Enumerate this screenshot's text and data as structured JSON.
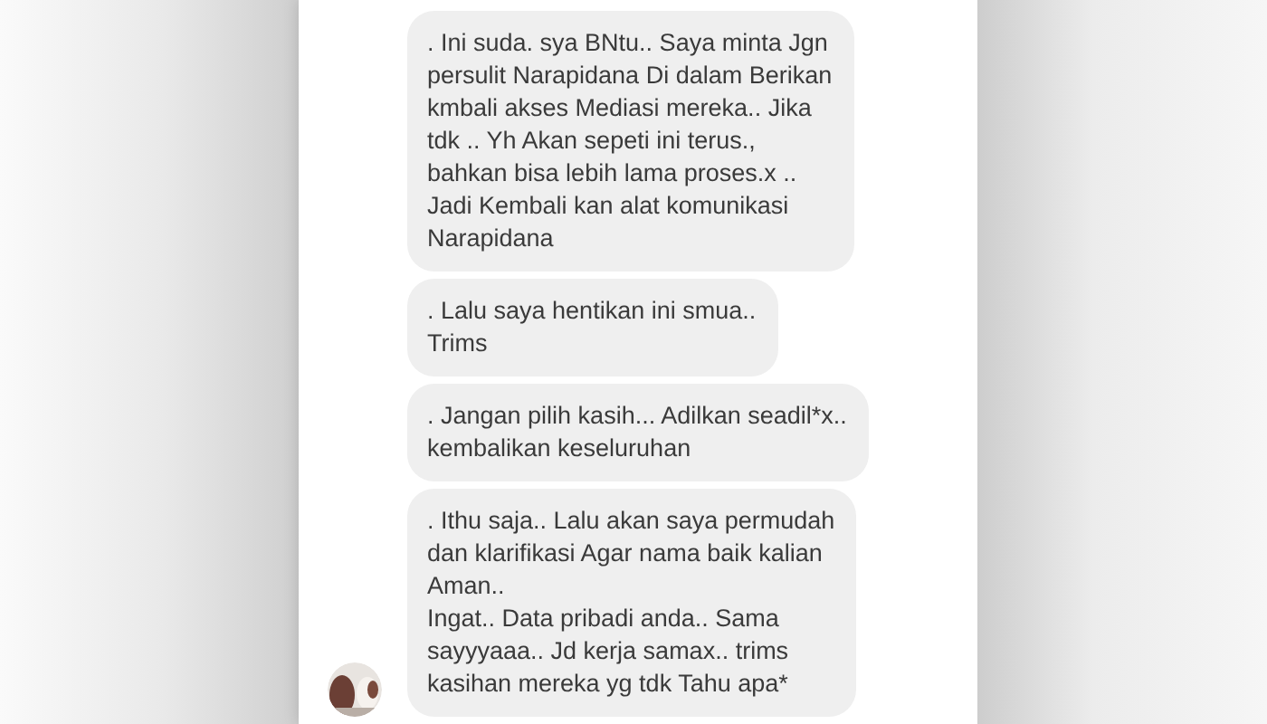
{
  "messages": [
    {
      "text": ". Ini suda. sya BNtu.. Saya minta Jgn\npersulit Narapidana Di dalam Berikan\nkmbali akses Mediasi mereka.. Jika\ntdk .. Yh Akan sepeti ini terus.,\nbahkan bisa lebih lama proses.x ..\nJadi Kembali kan alat komunikasi\nNarapidana"
    },
    {
      "text": ". Lalu saya hentikan ini smua..\nTrims"
    },
    {
      "text": ". Jangan pilih kasih... Adilkan seadil*x..\nkembalikan keseluruhan"
    },
    {
      "text": ". Ithu saja.. Lalu akan saya permudah\ndan klarifikasi Agar nama baik kalian\nAman..\nIngat.. Data pribadi anda.. Sama\nsayyyaaa.. Jd kerja samax.. trims\nkasihan mereka yg tdk Tahu apa*"
    }
  ]
}
